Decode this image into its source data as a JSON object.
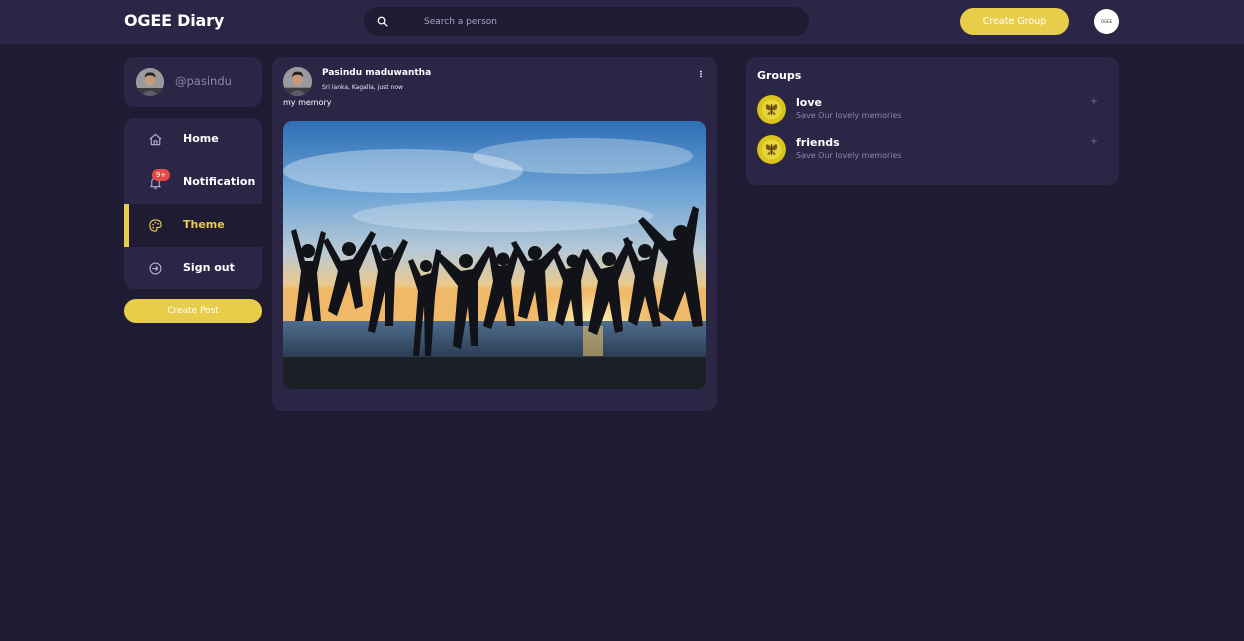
{
  "app": {
    "title": "OGEE Diary"
  },
  "search": {
    "placeholder": "Search a person",
    "icon": "search-icon"
  },
  "header": {
    "create_group_label": "Create Group",
    "avatar_text": "OGEE"
  },
  "profile": {
    "handle": "@pasindu"
  },
  "nav": {
    "items": [
      {
        "label": "Home",
        "icon": "home-icon",
        "active": false
      },
      {
        "label": "Notification",
        "icon": "bell-icon",
        "badge": "9+",
        "active": false
      },
      {
        "label": "Theme",
        "icon": "palette-icon",
        "active": true
      },
      {
        "label": "Sign out",
        "icon": "sign-out-icon",
        "active": false
      }
    ]
  },
  "create_post_label": "Create Post",
  "post": {
    "author": "Pasindu maduwantha",
    "meta": "Sri lanka, Kagalla, just now",
    "caption": "my memory",
    "image": "silhouettes of friends jumping at sunset on a beach"
  },
  "groups": {
    "title": "Groups",
    "items": [
      {
        "name": "love",
        "description": "Save Our lovely memories"
      },
      {
        "name": "friends",
        "description": "Save Our lovely memories"
      }
    ]
  },
  "colors": {
    "background": "#1f1b33",
    "panel": "#2b2546",
    "accent": "#e8cd4a",
    "badge": "#e54848",
    "muted_text": "#8c87a8"
  }
}
